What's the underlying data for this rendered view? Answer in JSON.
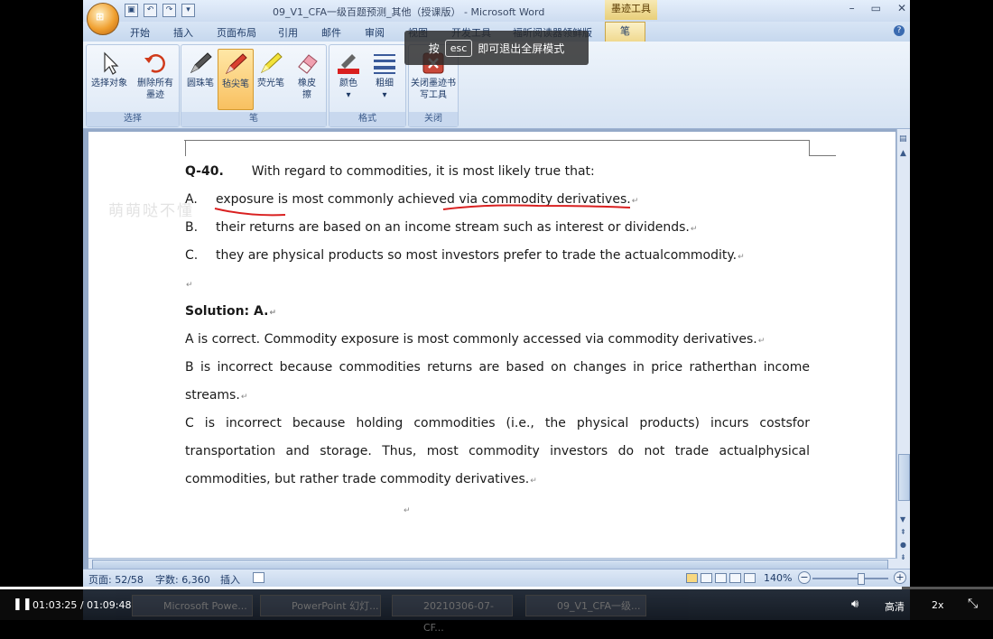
{
  "window": {
    "title": "09_V1_CFA一级百题预测_其他（授课版） - Microsoft Word",
    "context_tab": "墨迹工具",
    "min_icon": "minimize-icon",
    "max_icon": "restore-icon",
    "close_icon": "close-icon"
  },
  "ribbon_tabs": [
    "开始",
    "插入",
    "页面布局",
    "引用",
    "邮件",
    "审阅",
    "视图",
    "开发工具",
    "福昕阅读器领鲜版",
    "笔"
  ],
  "ribbon": {
    "groups": [
      {
        "title": "选择",
        "tools": [
          {
            "label": "选择对象",
            "icon": "cursor-icon"
          },
          {
            "label": "删除所有墨迹",
            "icon": "undo-eraser-icon"
          }
        ]
      },
      {
        "title": "笔",
        "tools": [
          {
            "label": "圆珠笔",
            "icon": "ballpoint-pen-icon"
          },
          {
            "label": "毡尖笔",
            "icon": "felt-pen-icon",
            "active": true
          },
          {
            "label": "荧光笔",
            "icon": "highlighter-icon"
          },
          {
            "label": "橡皮擦",
            "icon": "eraser-icon"
          }
        ]
      },
      {
        "title": "格式",
        "tools": [
          {
            "label": "颜色",
            "icon": "color-icon"
          },
          {
            "label": "粗细",
            "icon": "thickness-icon"
          }
        ]
      },
      {
        "title": "关闭",
        "tools": [
          {
            "label": "关闭墨迹书写工具",
            "icon": "close-ink-icon"
          }
        ]
      }
    ],
    "accent_pen": "#d92020"
  },
  "overlay": {
    "prefix": "按",
    "key": "esc",
    "suffix": "即可退出全屏模式"
  },
  "watermark": "萌萌哒不懂",
  "doc": {
    "question_number": "Q-40.",
    "question_text": "With regard to commodities, it is most likely true that:",
    "options": [
      {
        "letter": "A.",
        "text": "exposure is most commonly achieved via commodity derivatives."
      },
      {
        "letter": "B.",
        "text": "their returns are based on an income stream such as interest or dividends."
      },
      {
        "letter": "C.",
        "text": "they are physical products so most investors prefer to trade the actualcommodity."
      }
    ],
    "solution_label": "Solution: A.",
    "explanations": [
      "A is correct. Commodity exposure is most commonly accessed via commodity derivatives.",
      "B is incorrect because commodities returns are based on changes in price ratherthan income",
      "streams.",
      "C is incorrect because holding commodities (i.e., the physical products) incurs costsfor",
      "transportation and storage. Thus, most commodity investors do not trade actualphysical",
      "commodities, but rather trade commodity derivatives."
    ],
    "paragraph_mark": "↵"
  },
  "status": {
    "page": "页面: 52/58",
    "words": "字数: 6,360",
    "insert": "插入",
    "zoom": "140%"
  },
  "player": {
    "time": "01:03:25 / 01:09:48",
    "quality": "高清",
    "speed": "2x",
    "progress": 0.908
  },
  "taskbar": [
    "Microsoft Powe...",
    "PowerPoint 幻灯...",
    "20210306-07-CF...",
    "09_V1_CFA一级..."
  ]
}
